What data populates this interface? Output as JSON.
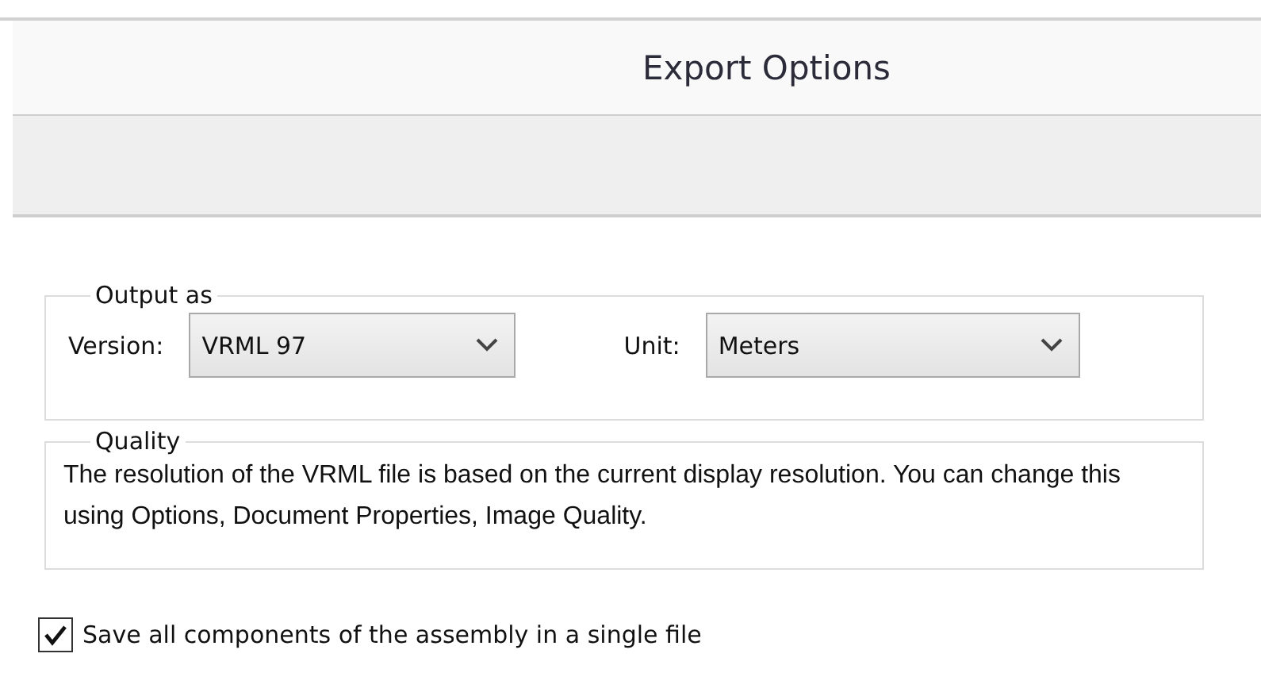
{
  "window": {
    "title": "Export Options"
  },
  "output_as": {
    "legend": "Output as",
    "version": {
      "label": "Version:",
      "value": "VRML 97"
    },
    "unit": {
      "label": "Unit:",
      "value": "Meters"
    }
  },
  "quality": {
    "legend": "Quality",
    "text": "The resolution of the VRML file is based on the current display resolution. You can change this using Options, Document Properties, Image Quality."
  },
  "save_single_file": {
    "label": "Save all components of the assembly in a single file",
    "checked": true
  }
}
